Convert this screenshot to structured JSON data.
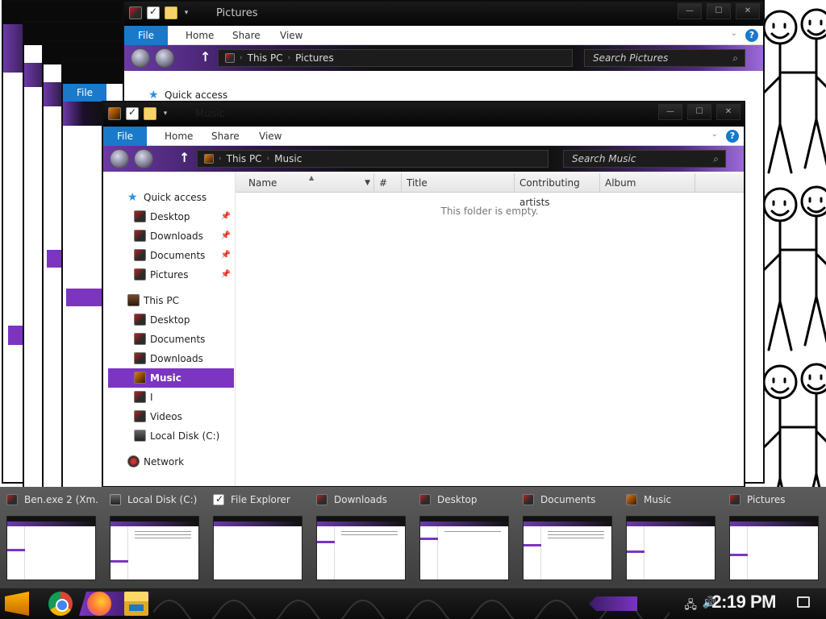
{
  "pictures_window": {
    "title": "Pictures",
    "ribbon": {
      "file": "File",
      "home": "Home",
      "share": "Share",
      "view": "View",
      "help": "?"
    },
    "address": {
      "root": "This PC",
      "current": "Pictures"
    },
    "search_placeholder": "Search Pictures",
    "nav_first": "Quick access"
  },
  "back_windows": {
    "file_label": "File"
  },
  "music_window": {
    "title": "Music",
    "ribbon": {
      "file": "File",
      "home": "Home",
      "share": "Share",
      "view": "View",
      "help": "?"
    },
    "address": {
      "root": "This PC",
      "current": "Music"
    },
    "search_placeholder": "Search Music",
    "nav": [
      {
        "label": "Quick access",
        "icon": "star-icon"
      },
      {
        "label": "Desktop",
        "icon": "desktop-folder-icon",
        "pinned": true
      },
      {
        "label": "Downloads",
        "icon": "downloads-folder-icon",
        "pinned": true
      },
      {
        "label": "Documents",
        "icon": "documents-folder-icon",
        "pinned": true
      },
      {
        "label": "Pictures",
        "icon": "pictures-folder-icon",
        "pinned": true
      },
      {
        "label": "This PC",
        "icon": "computer-icon"
      },
      {
        "label": "Desktop",
        "icon": "desktop-folder-icon"
      },
      {
        "label": "Documents",
        "icon": "documents-folder-icon"
      },
      {
        "label": "Downloads",
        "icon": "downloads-folder-icon"
      },
      {
        "label": "Music",
        "icon": "music-folder-icon",
        "selected": true
      },
      {
        "label": "I",
        "icon": "folder-icon"
      },
      {
        "label": "Videos",
        "icon": "videos-folder-icon"
      },
      {
        "label": "Local Disk (C:)",
        "icon": "drive-icon"
      },
      {
        "label": "Network",
        "icon": "network-icon"
      }
    ],
    "columns": {
      "name": "Name",
      "number": "#",
      "title": "Title",
      "artists": "Contributing artists",
      "album": "Album"
    },
    "empty_message": "This folder is empty."
  },
  "previews": [
    {
      "label": "Ben.exe 2 (Xm..."
    },
    {
      "label": "Local Disk (C:)"
    },
    {
      "label": "File Explorer"
    },
    {
      "label": "Downloads"
    },
    {
      "label": "Desktop"
    },
    {
      "label": "Documents"
    },
    {
      "label": "Music"
    },
    {
      "label": "Pictures"
    }
  ],
  "taskbar": {
    "clock": "2:19 PM",
    "apps": [
      "start-icon",
      "chrome-icon",
      "firefox-icon",
      "file-explorer-icon"
    ]
  },
  "colors": {
    "accent_blue": "#1979ca",
    "accent_purple": "#7b35c0",
    "window_chrome": "#0d0d0d"
  }
}
